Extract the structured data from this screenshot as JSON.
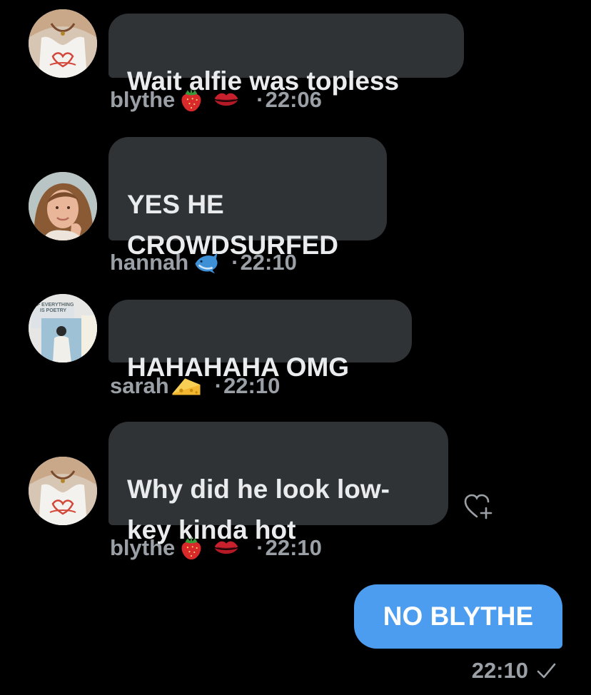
{
  "messages": [
    {
      "sender": "blythe",
      "text": "Wait alfie was topless",
      "time": "22:06",
      "emojis": [
        "strawberry-icon",
        "kiss-mark-icon"
      ]
    },
    {
      "sender": "hannah",
      "text": "YES HE\nCROWDSURFED",
      "time": "22:10",
      "emojis": [
        "dolphin-icon"
      ]
    },
    {
      "sender": "sarah",
      "text": "HAHAHAHA OMG",
      "time": "22:10",
      "emojis": [
        "cheese-icon"
      ]
    },
    {
      "sender": "blythe",
      "text": "Why did he look low-\nkey kinda hot",
      "time": "22:10",
      "emojis": [
        "strawberry-icon",
        "kiss-mark-icon"
      ]
    }
  ],
  "avatar_badge": {
    "line1": "IF EVERYTHING",
    "line2": "IS POETRY"
  },
  "separator": "·",
  "outgoing": {
    "text": "NO BLYTHE",
    "time": "22:10",
    "status_icon": "checkmark-icon"
  },
  "colors": {
    "background": "#000000",
    "incoming_bubble": "#2f3336",
    "outgoing_bubble": "#4c9cef",
    "meta_text": "#9aa0a6"
  }
}
